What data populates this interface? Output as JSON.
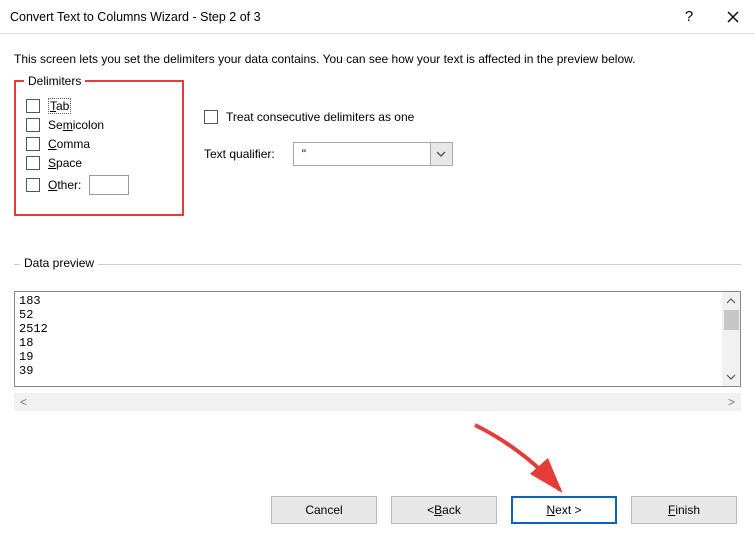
{
  "title": "Convert Text to Columns Wizard - Step 2 of 3",
  "intro": "This screen lets you set the delimiters your data contains.  You can see how your text is affected in the preview below.",
  "delimiters": {
    "legend": "Delimiters",
    "tab": "ab",
    "tab_u": "T",
    "semi": "Se",
    "semi_rest": "icolon",
    "semi_u": "m",
    "comma": "omma",
    "comma_u": "C",
    "space": "pace",
    "space_u": "S",
    "other": "ther:",
    "other_u": "O"
  },
  "treat": {
    "pre": "T",
    "u": "r",
    "post": "eat consecutive delimiters as one"
  },
  "qualifier": {
    "label_pre": "Text ",
    "label_u": "q",
    "label_post": "ualifier:",
    "value": "\""
  },
  "preview": {
    "legend": "Data preview",
    "lines": [
      "183",
      "52",
      "2512",
      "18",
      "19",
      "39"
    ]
  },
  "buttons": {
    "cancel": "Cancel",
    "back_pre": "< ",
    "back_u": "B",
    "back_post": "ack",
    "next_u": "N",
    "next_post": "ext >",
    "finish_u": "F",
    "finish_post": "inish"
  }
}
